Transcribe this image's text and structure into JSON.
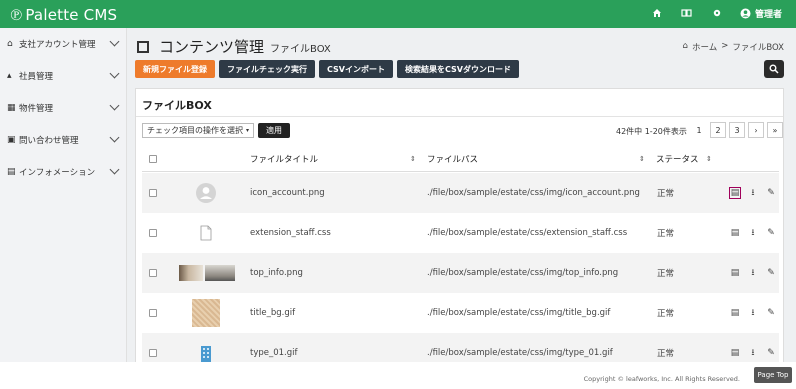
{
  "app": {
    "logo_text": "Palette CMS"
  },
  "topbar": {
    "admin_label": "管理者"
  },
  "sidebar": {
    "items": [
      {
        "label": "支社アカウント管理",
        "icon": "home-icon"
      },
      {
        "label": "社員管理",
        "icon": "user-icon"
      },
      {
        "label": "物件管理",
        "icon": "building-icon"
      },
      {
        "label": "問い合わせ管理",
        "icon": "inbox-icon"
      },
      {
        "label": "インフォメーション",
        "icon": "document-icon"
      }
    ]
  },
  "page": {
    "title": "コンテンツ管理",
    "subtitle": "ファイルBOX",
    "breadcrumb": {
      "home": "ホーム",
      "sep": ">",
      "current": "ファイルBOX"
    }
  },
  "actions": {
    "new_file": "新規ファイル登録",
    "file_check": "ファイルチェック実行",
    "csv_import": "CSVインポート",
    "csv_download": "検索結果をCSVダウンロード"
  },
  "panel": {
    "title": "ファイルBOX",
    "bulk_select": "チェック項目の操作を選択",
    "apply": "適用",
    "count": "42件中 1-20件表示",
    "pages": [
      "1",
      "2",
      "3",
      "›",
      "»"
    ]
  },
  "table": {
    "headers": {
      "title": "ファイルタイトル",
      "path": "ファイルパス",
      "status": "ステータス"
    },
    "rows": [
      {
        "title": "icon_account.png",
        "path": "./file/box/sample/estate/css/img/icon_account.png",
        "status": "正常",
        "thumb": "account"
      },
      {
        "title": "extension_staff.css",
        "path": "./file/box/sample/estate/css/extension_staff.css",
        "status": "正常",
        "thumb": "css"
      },
      {
        "title": "top_info.png",
        "path": "./file/box/sample/estate/css/img/top_info.png",
        "status": "正常",
        "thumb": "photo"
      },
      {
        "title": "title_bg.gif",
        "path": "./file/box/sample/estate/css/img/title_bg.gif",
        "status": "正常",
        "thumb": "texture"
      },
      {
        "title": "type_01.gif",
        "path": "./file/box/sample/estate/css/img/type_01.gif",
        "status": "正常",
        "thumb": "building"
      }
    ]
  },
  "footer": {
    "copyright": "Copyright © leafworks, Inc. All Rights Reserved.",
    "page_top": "Page Top"
  },
  "colors": {
    "brand_green": "#2aa05a",
    "orange": "#ee7b2b",
    "dark": "#2e3a46",
    "highlight": "#a0005a"
  }
}
